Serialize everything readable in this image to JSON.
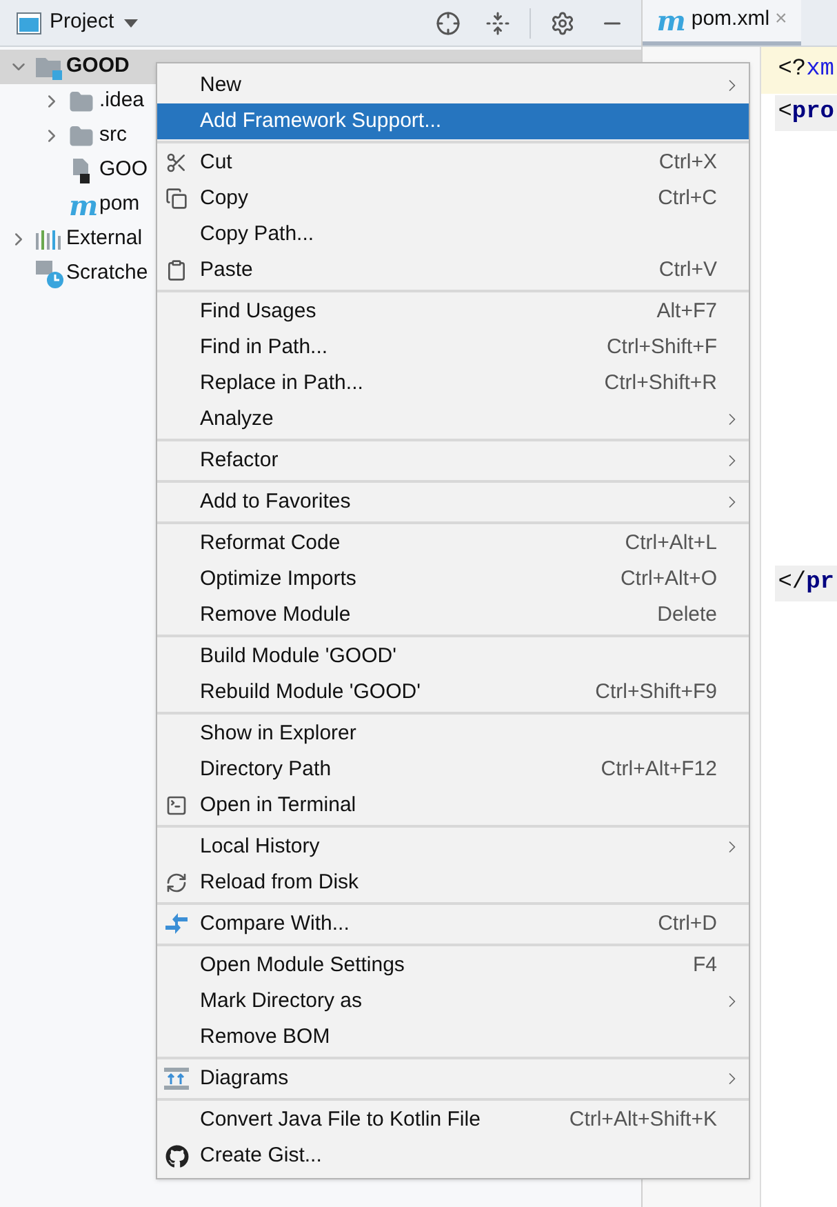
{
  "project_panel": {
    "title": "Project",
    "tree": [
      {
        "label": "GOOD",
        "kind": "module",
        "expanded": true,
        "selected": true,
        "children": [
          {
            "label": ".idea",
            "kind": "folder",
            "expanded": false,
            "selected": false
          },
          {
            "label": "src",
            "kind": "folder",
            "expanded": false,
            "selected": false
          },
          {
            "label": "GOO",
            "kind": "file",
            "selected": false
          },
          {
            "label": "pom",
            "kind": "maven",
            "glyph": "m",
            "selected": false
          }
        ]
      },
      {
        "label": "External",
        "kind": "libraries",
        "expanded": false,
        "selected": false
      },
      {
        "label": "Scratche",
        "kind": "scratches",
        "selected": false
      }
    ]
  },
  "editor": {
    "tab": {
      "label": "pom.xml",
      "glyph": "m",
      "close": "×"
    },
    "lines": [
      {
        "kind": "current",
        "tokens": [
          {
            "text": "<?",
            "kind": "punct"
          },
          {
            "text": "xm",
            "kind": "name"
          }
        ]
      },
      {
        "kind": "block",
        "tokens": [
          {
            "text": "<",
            "kind": "punct"
          },
          {
            "text": "pro",
            "kind": "tag"
          }
        ]
      },
      {
        "kind": "closing",
        "tokens": [
          {
            "text": "</",
            "kind": "punct"
          },
          {
            "text": "pr",
            "kind": "tag"
          }
        ]
      }
    ]
  },
  "context_menu": {
    "sections": [
      [
        {
          "label": "New",
          "submenu": true,
          "selected": false
        },
        {
          "label": "Add Framework Support...",
          "selected": true
        }
      ],
      [
        {
          "label": "Cut",
          "shortcut": "Ctrl+X",
          "kind": "scissors",
          "selected": false
        },
        {
          "label": "Copy",
          "shortcut": "Ctrl+C",
          "kind": "copy",
          "selected": false
        },
        {
          "label": "Copy Path...",
          "selected": false
        },
        {
          "label": "Paste",
          "shortcut": "Ctrl+V",
          "kind": "clipboard",
          "selected": false
        }
      ],
      [
        {
          "label": "Find Usages",
          "shortcut": "Alt+F7",
          "selected": false
        },
        {
          "label": "Find in Path...",
          "shortcut": "Ctrl+Shift+F",
          "selected": false
        },
        {
          "label": "Replace in Path...",
          "shortcut": "Ctrl+Shift+R",
          "selected": false
        },
        {
          "label": "Analyze",
          "submenu": true,
          "selected": false
        }
      ],
      [
        {
          "label": "Refactor",
          "submenu": true,
          "selected": false
        }
      ],
      [
        {
          "label": "Add to Favorites",
          "submenu": true,
          "selected": false
        }
      ],
      [
        {
          "label": "Reformat Code",
          "shortcut": "Ctrl+Alt+L",
          "selected": false
        },
        {
          "label": "Optimize Imports",
          "shortcut": "Ctrl+Alt+O",
          "selected": false
        },
        {
          "label": "Remove Module",
          "shortcut": "Delete",
          "selected": false
        }
      ],
      [
        {
          "label": "Build Module 'GOOD'",
          "selected": false
        },
        {
          "label": "Rebuild Module 'GOOD'",
          "shortcut": "Ctrl+Shift+F9",
          "selected": false
        }
      ],
      [
        {
          "label": "Show in Explorer",
          "selected": false
        },
        {
          "label": "Directory Path",
          "shortcut": "Ctrl+Alt+F12",
          "selected": false
        },
        {
          "label": "Open in Terminal",
          "kind": "terminal",
          "selected": false
        }
      ],
      [
        {
          "label": "Local History",
          "submenu": true,
          "selected": false
        },
        {
          "label": "Reload from Disk",
          "kind": "reload",
          "selected": false
        }
      ],
      [
        {
          "label": "Compare With...",
          "shortcut": "Ctrl+D",
          "kind": "compare",
          "selected": false
        }
      ],
      [
        {
          "label": "Open Module Settings",
          "shortcut": "F4",
          "selected": false
        },
        {
          "label": "Mark Directory as",
          "submenu": true,
          "selected": false
        },
        {
          "label": "Remove BOM",
          "selected": false
        }
      ],
      [
        {
          "label": "Diagrams",
          "submenu": true,
          "kind": "diagram",
          "selected": false
        }
      ],
      [
        {
          "label": "Convert Java File to Kotlin File",
          "shortcut": "Ctrl+Alt+Shift+K",
          "selected": false
        },
        {
          "label": "Create Gist...",
          "kind": "github",
          "selected": false
        }
      ]
    ]
  }
}
